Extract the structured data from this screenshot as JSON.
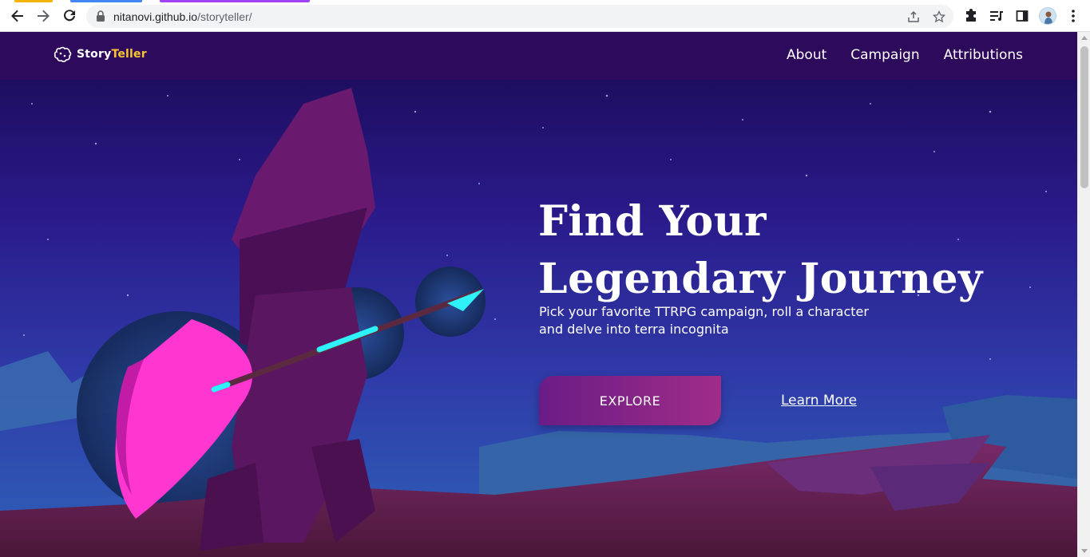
{
  "browser": {
    "url_host": "nitanovi.github.io",
    "url_path": "/storyteller/",
    "icons": {
      "back": "arrow-left-icon",
      "forward": "arrow-right-icon",
      "reload": "reload-icon",
      "lock": "lock-icon",
      "share": "share-icon",
      "bookmark": "star-icon",
      "extensions": "puzzle-icon",
      "media": "media-queue-icon",
      "side_panel": "side-panel-icon",
      "menu": "kebab-menu-icon"
    }
  },
  "site": {
    "logo": {
      "prefix": "Story",
      "accent": "Teller",
      "accent_color": "#f7c531"
    },
    "nav": [
      {
        "label": "About"
      },
      {
        "label": "Campaign"
      },
      {
        "label": "Attributions"
      }
    ],
    "nav_bg": "#2e0a5c"
  },
  "hero": {
    "title_line1": "Find Your",
    "title_line2": "Legendary Journey",
    "subtitle_line1": "Pick your favorite TTRPG campaign, roll a character",
    "subtitle_line2": "and delve into terra incognita",
    "explore_label": "EXPLORE",
    "learn_more_label": "Learn More"
  }
}
